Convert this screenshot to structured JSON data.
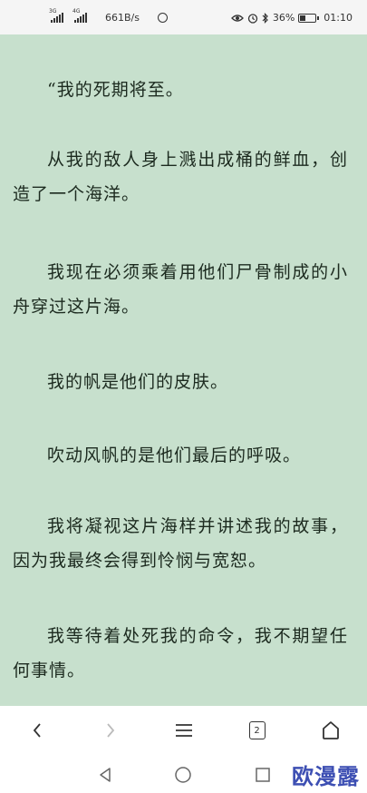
{
  "status_bar": {
    "signal1_label": "3G",
    "signal2_label": "4G",
    "speed": "661B/s",
    "battery": "36%",
    "time": "01:10",
    "icons": [
      "eye-icon",
      "alarm-icon",
      "bluetooth-icon",
      "battery-icon"
    ]
  },
  "reader": {
    "background": "#c7e0cd",
    "paragraphs": [
      "“我的死期将至。",
      "从我的敌人身上溅出成桶的鲜血，创造了一个海洋。",
      "我现在必须乘着用他们尸骨制成的小舟穿过这片海。",
      "我的帆是他们的皮肤。",
      "吹动风帆的是他们最后的呼吸。",
      "我将凝视这片海样并讲述我的故事，因为我最终会得到怜悯与宽恕。",
      "我等待着处死我的命令，我不期望任何事情。"
    ]
  },
  "toolbar": {
    "tab_count": "2",
    "icons": [
      "back-icon",
      "forward-icon",
      "menu-icon",
      "tabs-icon",
      "home-icon"
    ]
  },
  "system_nav": {
    "icons": [
      "nav-back-icon",
      "nav-home-icon",
      "nav-recents-icon"
    ]
  },
  "watermark": "欧漫露"
}
